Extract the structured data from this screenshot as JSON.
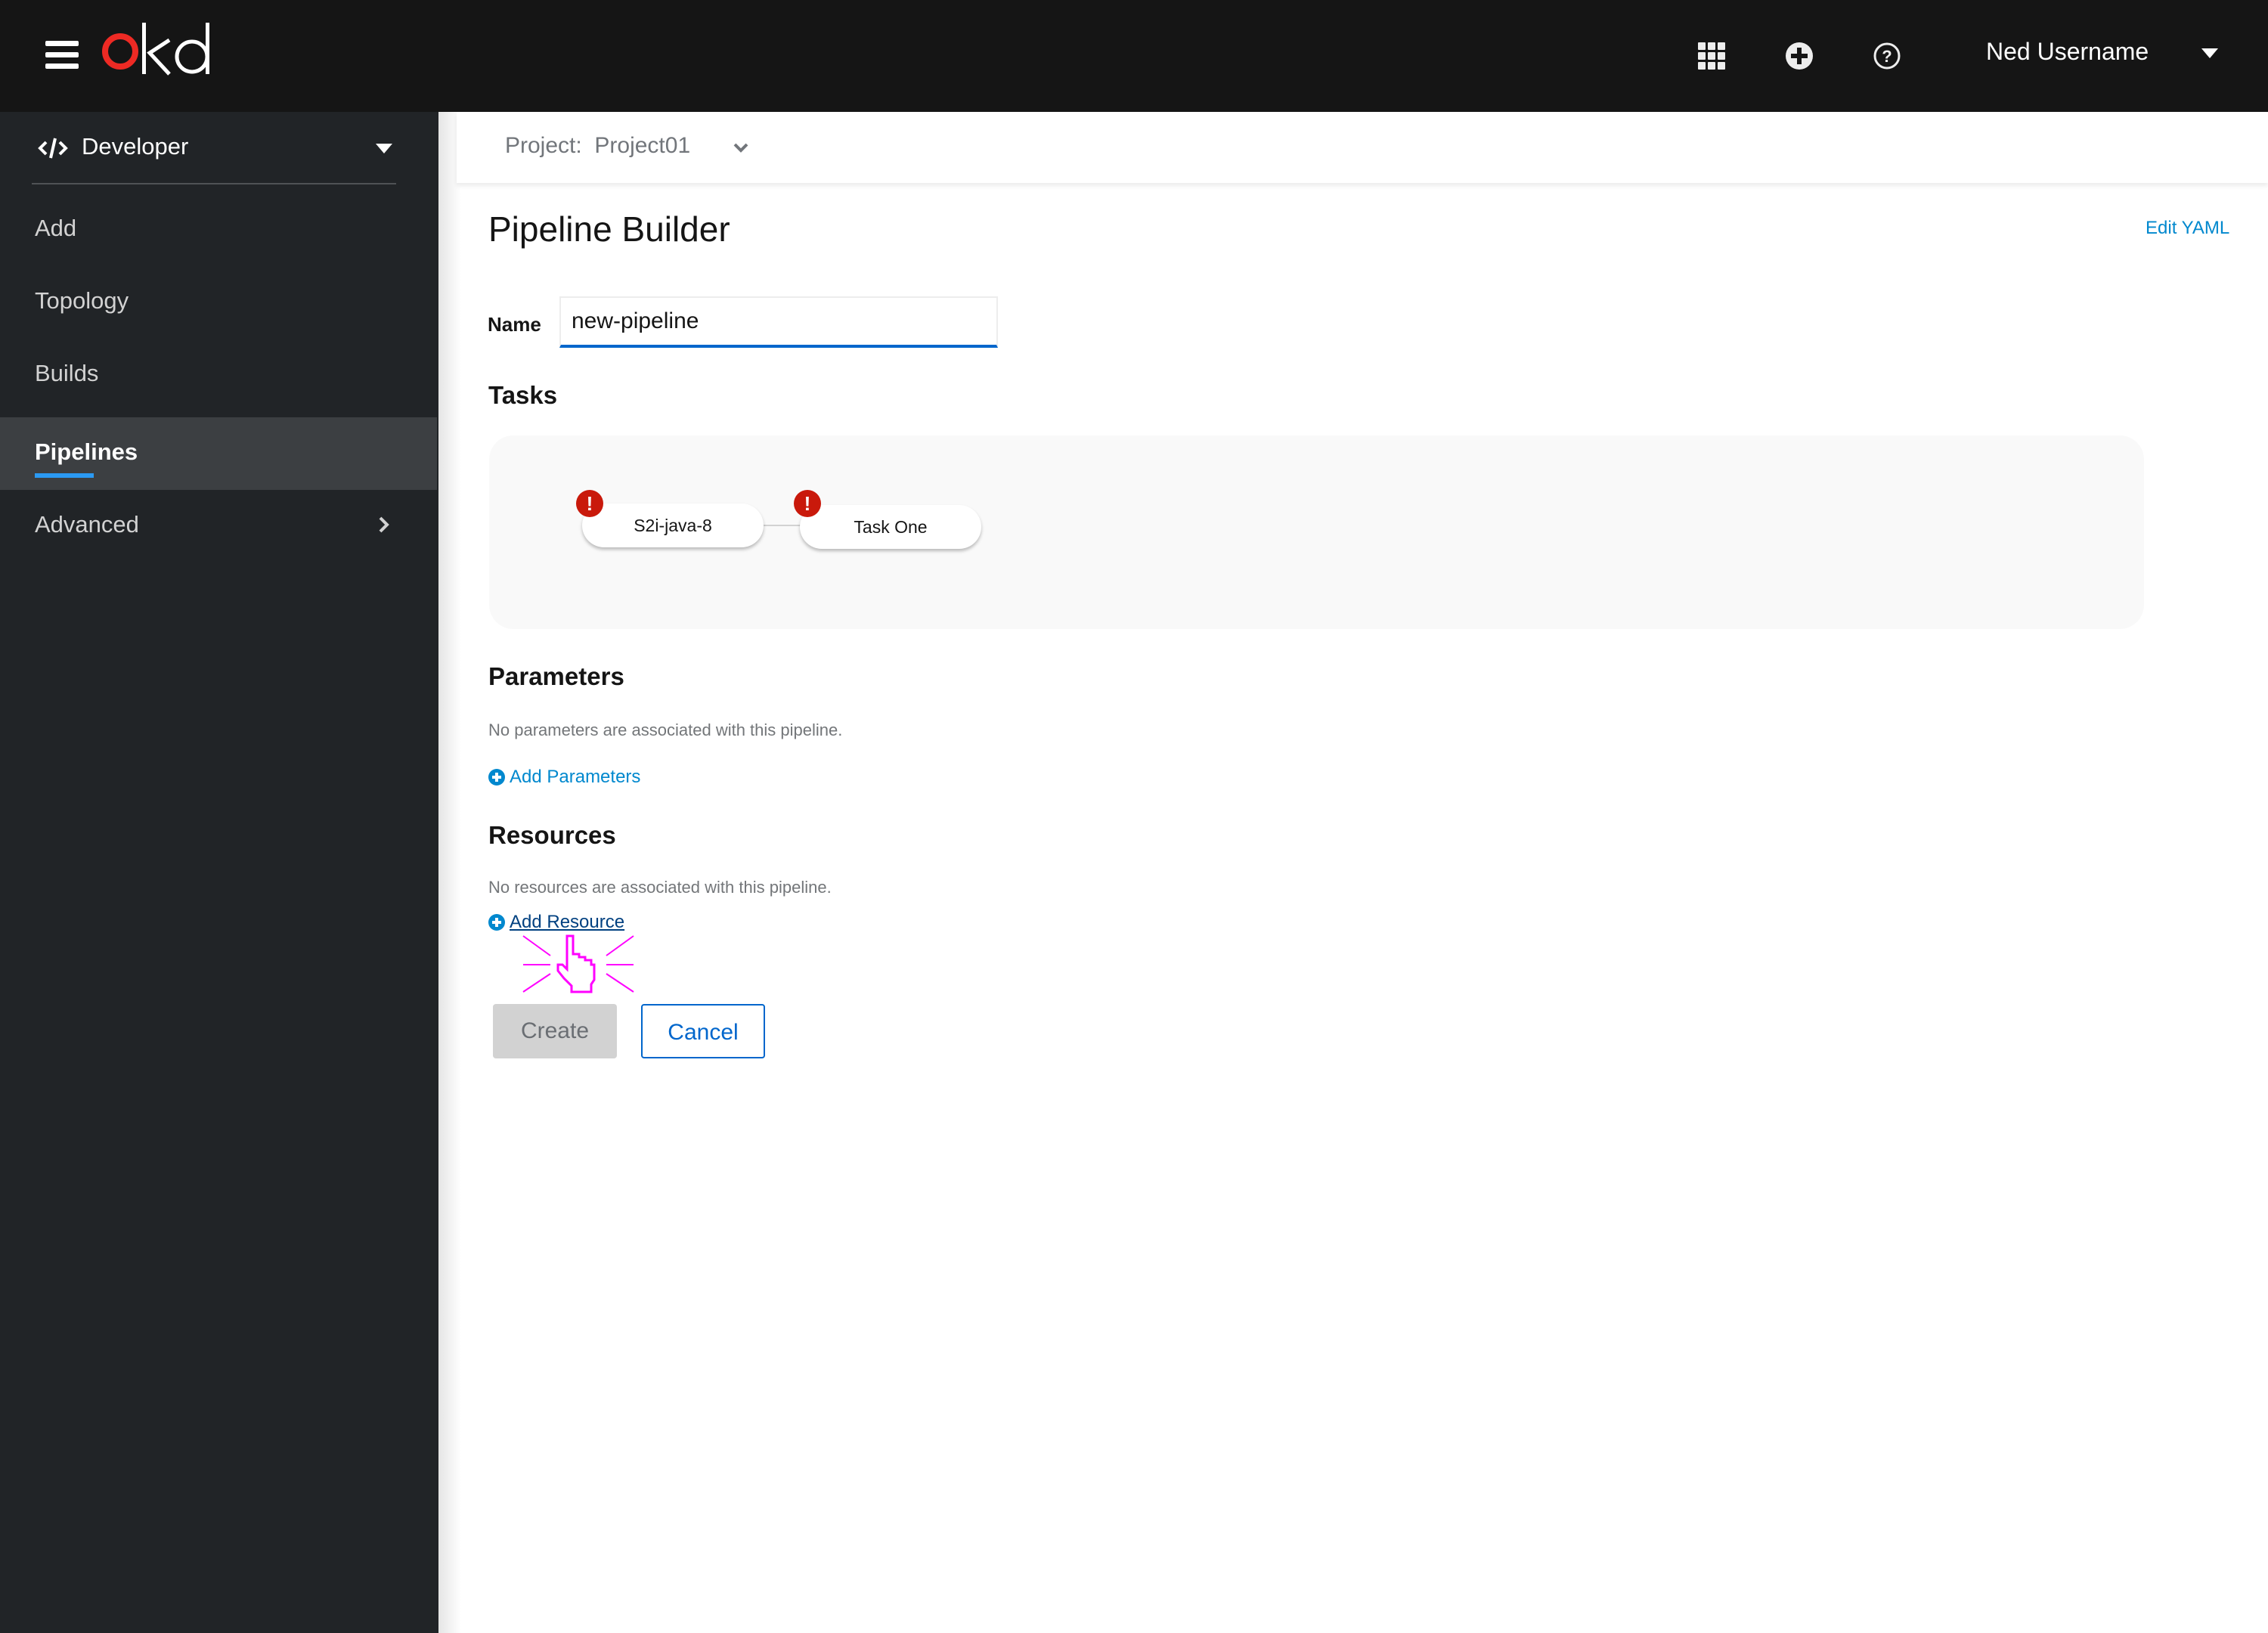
{
  "masthead": {
    "brand": "okd",
    "brand_colors": {
      "o": "#ee2a24",
      "kd": "#ffffff"
    },
    "icons": [
      "app-launcher-icon",
      "add-icon",
      "help-icon"
    ],
    "user_name": "Ned Username"
  },
  "sidebar": {
    "perspective": {
      "icon": "code-icon",
      "label": "Developer"
    },
    "items": [
      {
        "label": "Add",
        "active": false
      },
      {
        "label": "Topology",
        "active": false
      },
      {
        "label": "Builds",
        "active": false
      },
      {
        "label": "Pipelines",
        "active": true
      },
      {
        "label": "Advanced",
        "active": false,
        "has_children": true
      }
    ],
    "active_indicator_color": "#2b9af3"
  },
  "project_bar": {
    "label": "Project:",
    "value": "Project01"
  },
  "page": {
    "title": "Pipeline Builder",
    "edit_yaml_link": "Edit YAML"
  },
  "form": {
    "name_label": "Name",
    "name_value": "new-pipeline",
    "tasks_title": "Tasks",
    "tasks": [
      {
        "name": "S2i-java-8",
        "status": "error"
      },
      {
        "name": "Task One",
        "status": "error"
      }
    ],
    "parameters_title": "Parameters",
    "parameters_empty": "No parameters are associated with this pipeline.",
    "add_parameters_label": "Add Parameters",
    "resources_title": "Resources",
    "resources_empty": "No resources are associated with this pipeline.",
    "add_resource_label": "Add Resource",
    "create_label": "Create",
    "cancel_label": "Cancel",
    "error_badge_color": "#c9190b",
    "link_color": "#0088ce"
  }
}
